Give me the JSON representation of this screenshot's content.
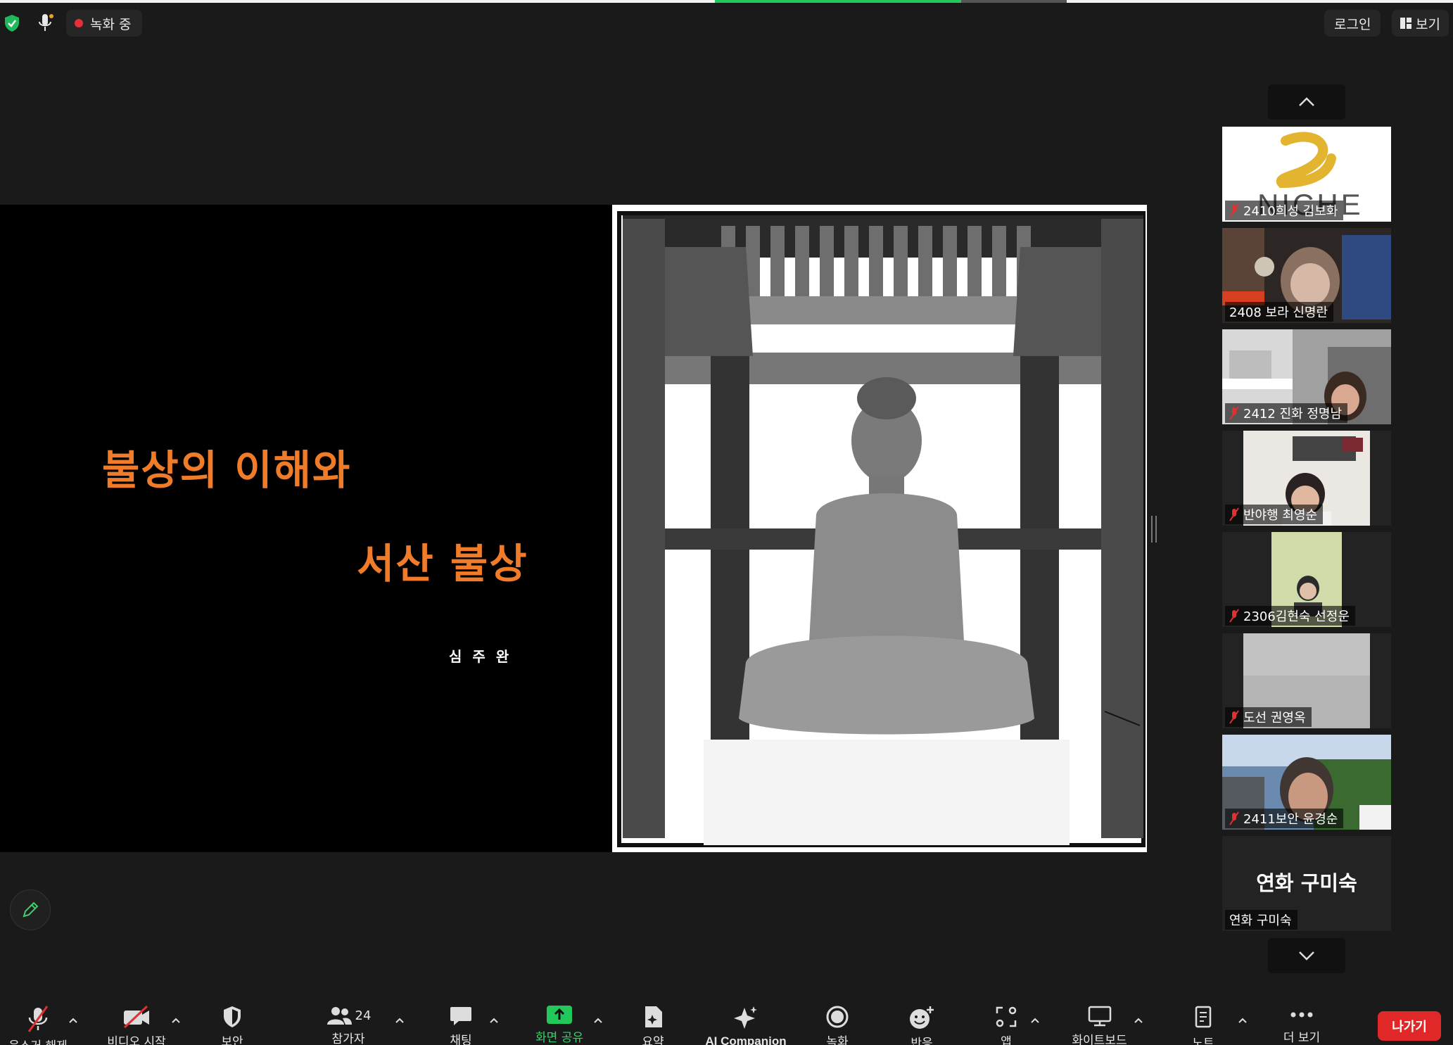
{
  "topbar": {
    "recording_label": "녹화 중",
    "login_label": "로그인",
    "view_label": "보기"
  },
  "slide": {
    "title_line1": "불상의 이해와",
    "title_line2": "서산 불상",
    "author": "심 주 완"
  },
  "gallery": {
    "tiles": [
      {
        "name": "2410희성 김보화",
        "muted": true,
        "bg_text": "NICHE"
      },
      {
        "name": "2408 보라 신명란",
        "muted": false
      },
      {
        "name": "2412 진화 정명남",
        "muted": true
      },
      {
        "name": "반야행 최영순",
        "muted": true
      },
      {
        "name": "2306김현숙 선정운",
        "muted": true
      },
      {
        "name": "도선 권영옥",
        "muted": true
      },
      {
        "name": "2411보안 윤경순",
        "muted": true
      },
      {
        "name": "연화 구미숙",
        "muted": false,
        "display_name": "연화 구미숙"
      }
    ]
  },
  "toolbar": {
    "unmute": "음소거 해제",
    "start_video": "비디오 시작",
    "security": "보안",
    "participants": "참가자",
    "participants_count": "24",
    "chat": "채팅",
    "share_screen": "화면 공유",
    "summary": "요약",
    "ai_companion": "AI Companion",
    "record": "녹화",
    "reactions": "반응",
    "apps": "앱",
    "whiteboard": "화이트보드",
    "notes": "노트",
    "more": "더 보기",
    "leave": "나가기"
  },
  "colors": {
    "accent_green": "#23c85a",
    "slide_orange": "#f07b28",
    "leave_red": "#e02828",
    "record_red": "#e5303a"
  }
}
